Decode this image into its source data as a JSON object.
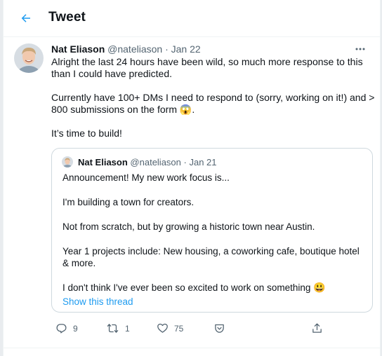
{
  "header": {
    "title": "Tweet",
    "back_icon": "arrow-left-icon"
  },
  "tweet": {
    "author_name": "Nat Eliason",
    "handle": "@nateliason",
    "dot": "·",
    "date": "Jan 22",
    "paragraphs": [
      "Alright the last 24 hours have been wild, so much more response to this than I could have predicted.",
      "Currently have 100+ DMs I need to respond to (sorry, working on it!) and > 800 submissions on the form",
      "It’s time to build!"
    ],
    "emoji_scream": "😱",
    "period": "."
  },
  "quote": {
    "author_name": "Nat Eliason",
    "handle": "@nateliason",
    "dot": "·",
    "date": "Jan 21",
    "paragraphs": [
      "Announcement! My new work focus is...",
      "I'm building a town for creators.",
      "Not from scratch, but by growing a historic town near Austin.",
      "Year 1 projects include: New housing, a coworking cafe, boutique hotel & more.",
      "I don't think I've ever been so excited to work on something"
    ],
    "emoji_smile": "😃",
    "show_thread": "Show this thread"
  },
  "actions": {
    "reply_count": "9",
    "retweet_count": "1",
    "like_count": "75"
  },
  "colors": {
    "accent": "#1d9bf0",
    "text": "#0f1419",
    "muted": "#536471",
    "border": "#cfd9de"
  }
}
